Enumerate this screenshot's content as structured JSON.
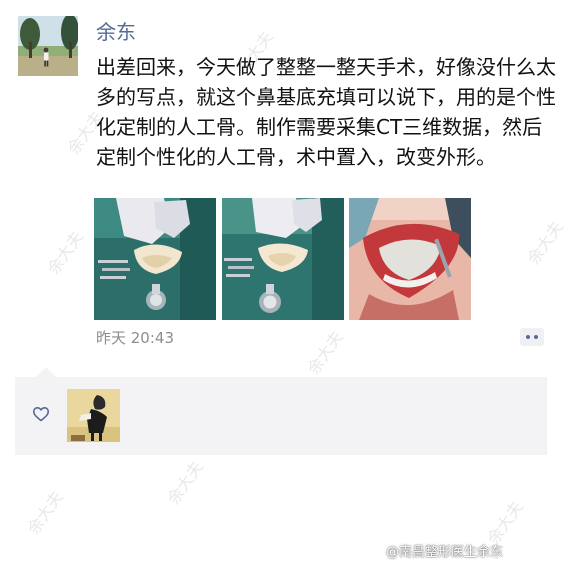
{
  "post": {
    "author": "余东",
    "text": "出差回来，今天做了整整一整天手术，好像没什么太多的写点，就这个鼻基底充填可以说下，用的是个性化定制的人工骨。制作需要采集CT三维数据，然后定制个性化的人工骨，术中置入，改变外形。",
    "timestamp": "昨天 20:43",
    "photos": [
      {
        "icon": "surgery-photo-implant-held"
      },
      {
        "icon": "surgery-photo-implant-tray"
      },
      {
        "icon": "surgery-photo-mouth-incision"
      }
    ]
  },
  "likes": {
    "icon": "heart-icon"
  },
  "source": {
    "credit": "@南昌整形医生余东"
  },
  "watermark": {
    "text": "余大夫"
  },
  "colors": {
    "name_link": "#576b95",
    "body_text": "#111111",
    "timestamp": "#8d8d8d",
    "likes_background": "#f3f3f5",
    "more_button_background": "#eef0f4"
  }
}
